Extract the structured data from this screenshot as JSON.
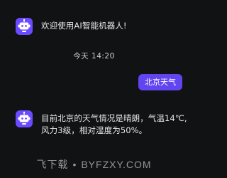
{
  "chat": {
    "bot_welcome": "欢迎使用AI智能机器人!",
    "timestamp": "今天 14:20",
    "user_message": "北京天气",
    "bot_reply_line1": "目前北京的天气情况是晴朗，气温14℃,",
    "bot_reply_line2": "风力3级，相对湿度为50%。"
  },
  "watermark": {
    "left": "飞下载",
    "dot": "•",
    "right": "BYFZXY.COM"
  },
  "colors": {
    "background": "#111214",
    "accent": "#6244f0",
    "avatar": "#6b4bff",
    "text": "#e6e6e8"
  },
  "icons": {
    "bot_avatar": "robot-icon"
  }
}
